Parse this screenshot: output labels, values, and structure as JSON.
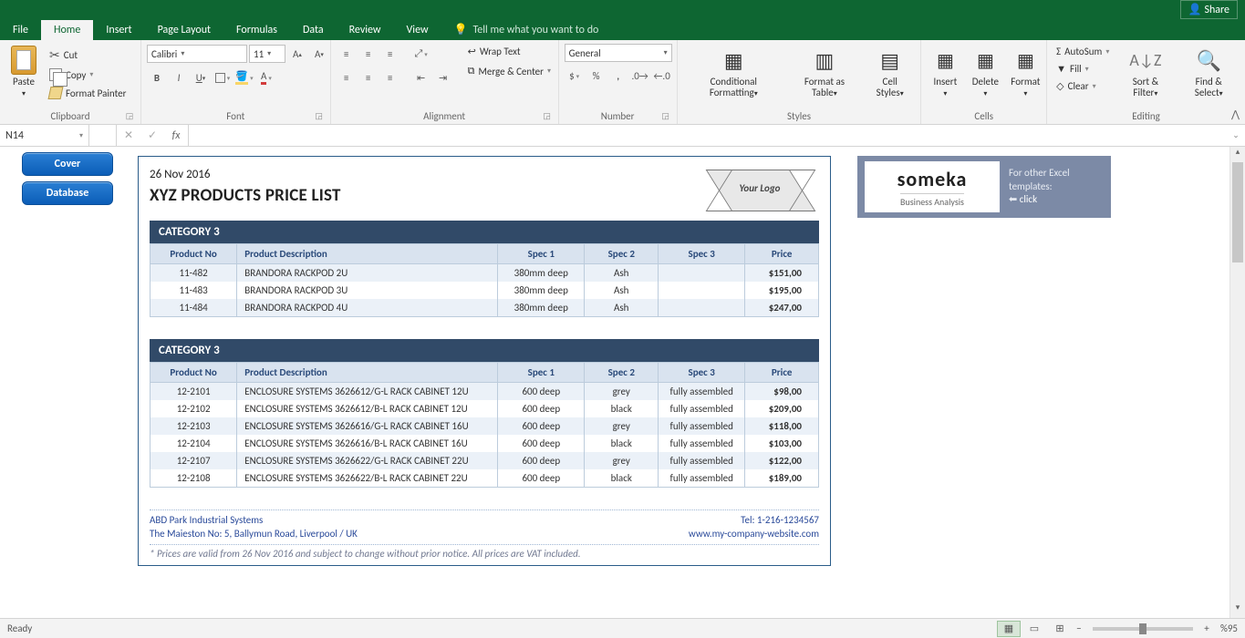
{
  "titlebar": {
    "share": "Share"
  },
  "tabs": [
    "File",
    "Home",
    "Insert",
    "Page Layout",
    "Formulas",
    "Data",
    "Review",
    "View"
  ],
  "active_tab": "Home",
  "tellme": "Tell me what you want to do",
  "ribbon": {
    "clipboard": {
      "label": "Clipboard",
      "paste": "Paste",
      "cut": "Cut",
      "copy": "Copy",
      "fp": "Format Painter"
    },
    "font": {
      "label": "Font",
      "name": "Calibri",
      "size": "11"
    },
    "alignment": {
      "label": "Alignment",
      "wrap": "Wrap Text",
      "merge": "Merge & Center"
    },
    "number": {
      "label": "Number",
      "fmt": "General"
    },
    "styles": {
      "label": "Styles",
      "cond": "Conditional Formatting",
      "fat": "Format as Table",
      "cell": "Cell Styles"
    },
    "cells": {
      "label": "Cells",
      "ins": "Insert",
      "del": "Delete",
      "fmt": "Format"
    },
    "editing": {
      "label": "Editing",
      "sum": "AutoSum",
      "fill": "Fill",
      "clear": "Clear",
      "sort": "Sort & Filter",
      "find": "Find & Select"
    }
  },
  "namebox": "N14",
  "sidebuttons": {
    "cover": "Cover",
    "database": "Database"
  },
  "doc": {
    "date": "26 Nov 2016",
    "title": "XYZ PRODUCTS PRICE LIST",
    "logo": "Your Logo",
    "cat1": {
      "name": "CATEGORY 3",
      "headers": [
        "Product No",
        "Product Description",
        "Spec 1",
        "Spec 2",
        "Spec 3",
        "Price"
      ],
      "rows": [
        [
          "11-482",
          "BRANDORA RACKPOD 2U",
          "380mm deep",
          "Ash",
          "",
          "$151,00"
        ],
        [
          "11-483",
          "BRANDORA RACKPOD 3U",
          "380mm deep",
          "Ash",
          "",
          "$195,00"
        ],
        [
          "11-484",
          "BRANDORA RACKPOD 4U",
          "380mm deep",
          "Ash",
          "",
          "$247,00"
        ]
      ]
    },
    "cat2": {
      "name": "CATEGORY 3",
      "headers": [
        "Product No",
        "Product Description",
        "Spec 1",
        "Spec 2",
        "Spec 3",
        "Price"
      ],
      "rows": [
        [
          "12-2101",
          "ENCLOSURE SYSTEMS 3626612/G-L RACK CABINET 12U",
          "600 deep",
          "grey",
          "fully assembled",
          "$98,00"
        ],
        [
          "12-2102",
          "ENCLOSURE SYSTEMS 3626612/B-L RACK CABINET 12U",
          "600 deep",
          "black",
          "fully assembled",
          "$209,00"
        ],
        [
          "12-2103",
          "ENCLOSURE SYSTEMS 3626616/G-L RACK CABINET 16U",
          "600 deep",
          "grey",
          "fully assembled",
          "$118,00"
        ],
        [
          "12-2104",
          "ENCLOSURE SYSTEMS 3626616/B-L RACK CABINET 16U",
          "600 deep",
          "black",
          "fully assembled",
          "$103,00"
        ],
        [
          "12-2107",
          "ENCLOSURE SYSTEMS 3626622/G-L RACK CABINET 22U",
          "600 deep",
          "grey",
          "fully assembled",
          "$122,00"
        ],
        [
          "12-2108",
          "ENCLOSURE SYSTEMS 3626622/B-L RACK CABINET 22U",
          "600 deep",
          "black",
          "fully assembled",
          "$189,00"
        ]
      ]
    },
    "footer": {
      "company": "ABD Park Industrial Systems",
      "tel": "Tel: 1-216-1234567",
      "addr": "The Maieston No: 5, Ballymun Road, Liverpool / UK",
      "site": "www.my-company-website.com",
      "note": "* Prices are valid from 26 Nov 2016 and subject to change without prior notice. All prices are VAT included."
    }
  },
  "promo": {
    "brand": "someka",
    "sub": "Business Analysis",
    "line1": "For other Excel",
    "line2": "templates:",
    "click": "click",
    "arrow": "⬅"
  },
  "status": {
    "ready": "Ready",
    "zoom": "%95"
  }
}
